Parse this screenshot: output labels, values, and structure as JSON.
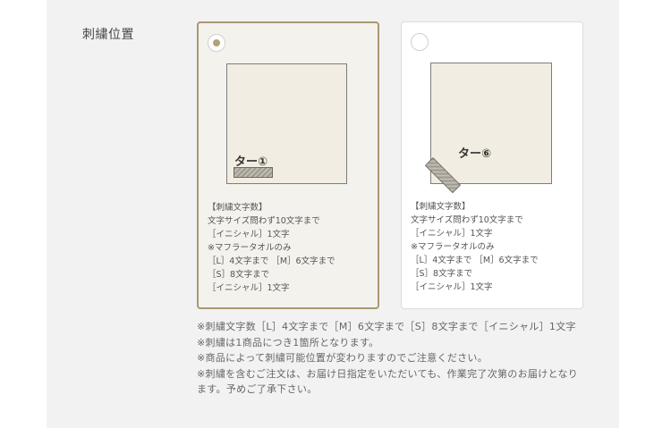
{
  "section": {
    "label": "刺繍位置"
  },
  "options": [
    {
      "selected": true,
      "position_label": "ター①",
      "description": [
        "【刺繍文字数】",
        "文字サイズ問わず10文字まで",
        "［イニシャル］1文字",
        "※マフラータオルのみ",
        "［L］4文字まで ［M］6文字まで",
        "［S］8文字まで",
        "［イニシャル］1文字"
      ]
    },
    {
      "selected": false,
      "position_label": "ター⑥",
      "description": [
        "【刺繍文字数】",
        "文字サイズ問わず10文字まで",
        "［イニシャル］1文字",
        "※マフラータオルのみ",
        "［L］4文字まで ［M］6文字まで",
        "［S］8文字まで",
        "［イニシャル］1文字"
      ]
    }
  ],
  "notes": [
    "※刺繍文字数［L］4文字まで［M］6文字まで［S］8文字まで［イニシャル］1文字",
    "※刺繍は1商品につき1箇所となります。",
    "※商品によって刺繍可能位置が変わりますのでご注意ください。",
    "※刺繍を含むご注文は、お届け日指定をいただいても、作業完了次第のお届けとなります。予めご了承下さい。"
  ],
  "colors": {
    "selected_border": "#a99873",
    "selected_bg": "#f4f2ed",
    "towel_fill": "#f1ede2",
    "panel_bg": "#f2f2f2"
  }
}
